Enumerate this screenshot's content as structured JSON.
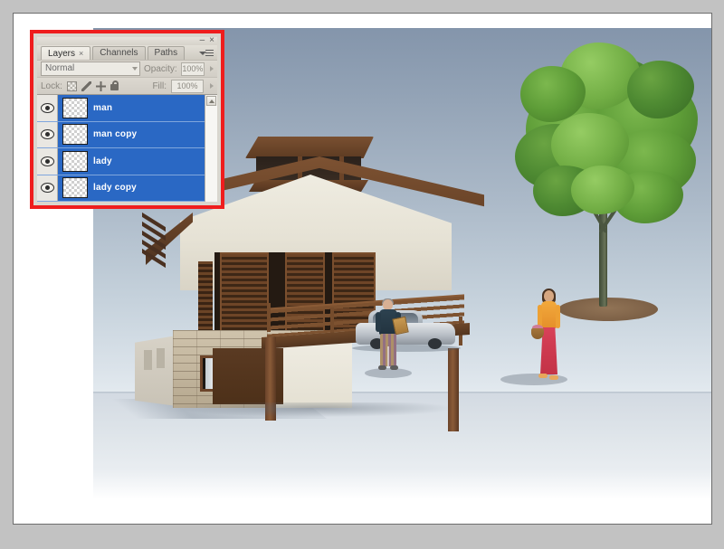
{
  "window": {
    "title_buttons": {
      "minimize": "–",
      "close": "×"
    }
  },
  "panel": {
    "tabs": [
      {
        "label": "Layers",
        "close": "×",
        "active": true
      },
      {
        "label": "Channels",
        "active": false
      },
      {
        "label": "Paths",
        "active": false
      }
    ],
    "menu_icon": "panel-menu-icon",
    "blend": {
      "mode_value": "Normal",
      "opacity_label": "Opacity:",
      "opacity_value": "100%"
    },
    "lock": {
      "label": "Lock:",
      "icons": [
        "lock-transparency-icon",
        "lock-image-icon",
        "lock-position-icon",
        "lock-all-icon"
      ],
      "fill_label": "Fill:",
      "fill_value": "100%"
    },
    "layers": [
      {
        "name": "man",
        "visible": true,
        "selected": true,
        "thumbnail": "transparent-checkerboard"
      },
      {
        "name": "man copy",
        "visible": true,
        "selected": true,
        "thumbnail": "transparent-checkerboard"
      },
      {
        "name": "lady",
        "visible": true,
        "selected": true,
        "thumbnail": "transparent-checkerboard"
      },
      {
        "name": "lady copy",
        "visible": true,
        "selected": true,
        "thumbnail": "transparent-checkerboard"
      }
    ],
    "scrollbar": {
      "up_arrow": "scroll-up-icon"
    }
  },
  "annotation": {
    "border_color": "#ef1d1d"
  },
  "canvas": {
    "description": "3D architectural rendering of a two-storey house with brown wooden roof, cream gable wall, wooden louvered panels, stacked stone veneer base, balcony railing over a carport with a silver car, a man holding a clipboard, a woman in an orange top and red skirt carrying a basket, and a large green tree at right",
    "sky_top_color": "#8495ab",
    "sky_bottom_color": "#e8eef2",
    "ground_color": "#d3dae2",
    "roof_color": "#6b4428",
    "wall_color": "#efece1",
    "stone_color": "#c3b69e",
    "tree_color": "#5d9c37",
    "lady_top_color": "#f2a93c",
    "lady_skirt_color": "#cf3a50",
    "man_shirt_color": "#22333f",
    "car_color": "#b9bfc6"
  }
}
